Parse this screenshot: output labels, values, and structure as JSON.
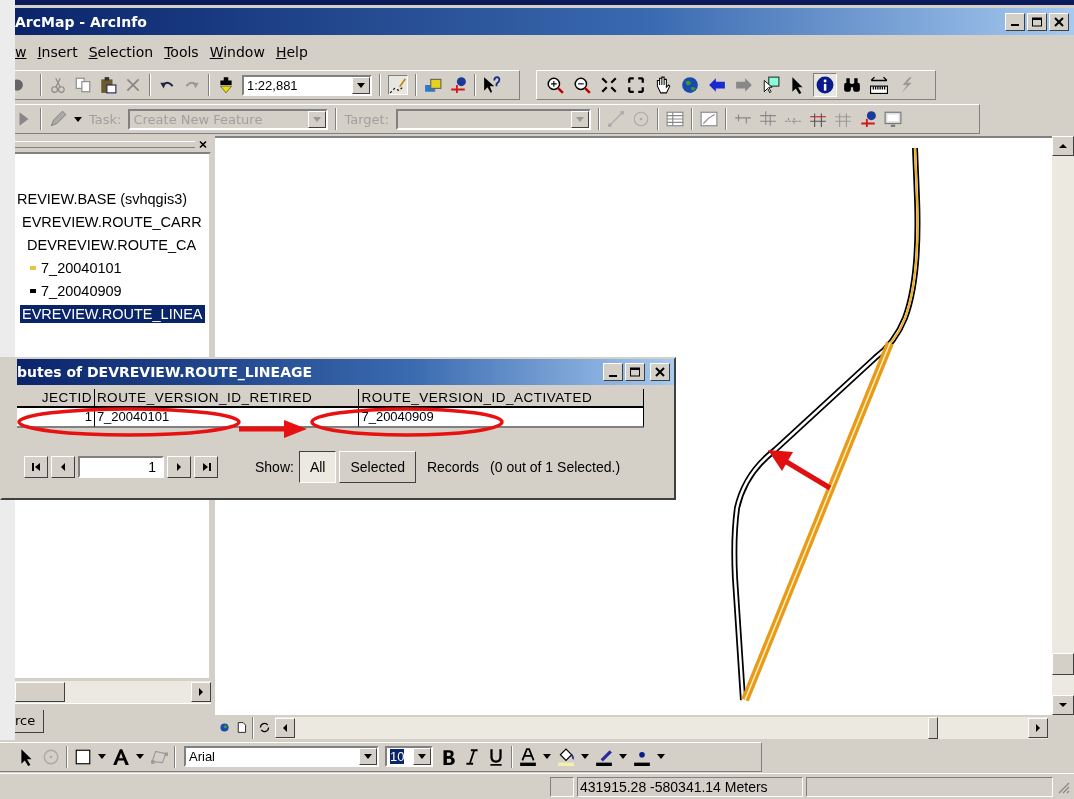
{
  "window": {
    "title": "ArcMap - ArcInfo"
  },
  "menu": [
    {
      "label": "w"
    },
    {
      "label": "Insert"
    },
    {
      "label": "Selection"
    },
    {
      "label": "Tools"
    },
    {
      "label": "Window"
    },
    {
      "label": "Help"
    }
  ],
  "standard_toolbar": {
    "scale": "1:22,881"
  },
  "tools_toolbar": [
    {
      "kind": "zoom-in",
      "selected": false
    },
    {
      "kind": "zoom-out",
      "selected": false
    },
    {
      "kind": "fixed-zoom-in",
      "selected": false
    },
    {
      "kind": "fixed-zoom-out",
      "selected": false
    },
    {
      "kind": "pan",
      "selected": false
    },
    {
      "kind": "full-extent",
      "selected": false
    },
    {
      "kind": "back",
      "selected": false
    },
    {
      "kind": "forward",
      "selected": false
    },
    {
      "kind": "select-features",
      "selected": false
    },
    {
      "kind": "select-elements",
      "selected": false
    },
    {
      "kind": "identify",
      "selected": true
    },
    {
      "kind": "find",
      "selected": false
    },
    {
      "kind": "measure",
      "selected": false
    },
    {
      "kind": "hyperlink",
      "selected": false
    }
  ],
  "editor_toolbar": {
    "disabled": true,
    "task_label": "Task:",
    "task": "Create New Feature",
    "target_label": "Target:"
  },
  "toc": {
    "items": [
      {
        "label": "REVIEW.BASE (svhqgis3)",
        "selected": false,
        "children": [
          {
            "label": "EVREVIEW.ROUTE_CARR",
            "selected": false,
            "children": [
              {
                "label": "DEVREVIEW.ROUTE_CA",
                "selected": false,
                "children": [
                  {
                    "label": "7_20040101",
                    "selected": false,
                    "color": "#f0c040"
                  },
                  {
                    "label": "7_20040909",
                    "selected": false,
                    "color": "#000000"
                  }
                ]
              }
            ]
          },
          {
            "label": "EVREVIEW.ROUTE_LINEA",
            "selected": true
          }
        ]
      }
    ],
    "tab": "rce"
  },
  "attribute_table": {
    "title": "butes of DEVREVIEW.ROUTE_LINEAGE",
    "columns": [
      "JECTID",
      "ROUTE_VERSION_ID_RETIRED",
      "ROUTE_VERSION_ID_ACTIVATED"
    ],
    "rows": [
      [
        "1",
        "7_20040101",
        "7_20040909"
      ]
    ],
    "record": "1",
    "show_label": "Show:",
    "show_options": [
      {
        "label": "All",
        "selected": true
      },
      {
        "label": "Selected",
        "selected": false
      }
    ],
    "records_label": "Records",
    "selection_summary": "(0 out of 1 Selected.)"
  },
  "drawing_toolbar": {
    "font": "Arial",
    "size": "10"
  },
  "status_bar": {
    "coordinates": "431915.28  -580341.14 Meters"
  }
}
